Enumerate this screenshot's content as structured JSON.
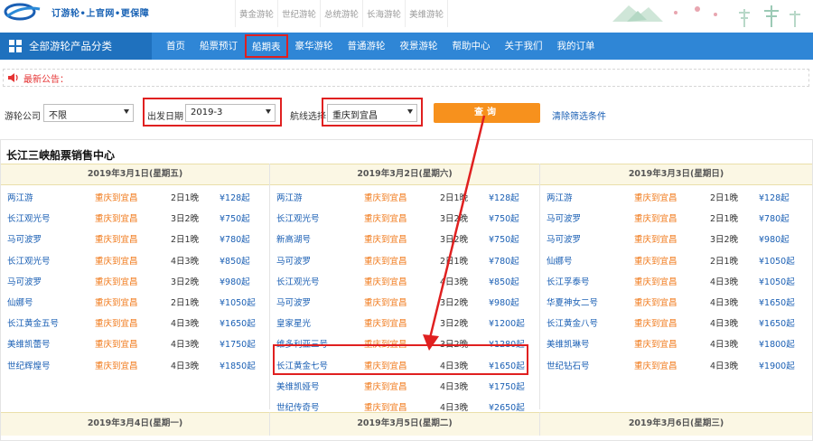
{
  "header": {
    "slogan": "订游轮•上官网•更保障",
    "top_links": [
      "黄金游轮",
      "世纪游轮",
      "总统游轮",
      "长海游轮",
      "美维游轮"
    ]
  },
  "nav": {
    "category_label": "全部游轮产品分类",
    "items": [
      "首页",
      "船票预订",
      "船期表",
      "豪华游轮",
      "普通游轮",
      "夜景游轮",
      "帮助中心",
      "关于我们",
      "我的订单"
    ],
    "active": "船期表"
  },
  "notice": {
    "label": "最新公告："
  },
  "filter": {
    "company_label": "游轮公司",
    "company_value": "不限",
    "date_label": "出发日期",
    "date_value": "2019-3",
    "route_label": "航线选择",
    "route_value": "重庆到宜昌",
    "query_label": "查询",
    "clear_label": "清除筛选条件"
  },
  "schedule": {
    "title": "长江三峡船票销售中心",
    "columns": [
      {
        "date": "2019年3月1日(星期五)",
        "rows": [
          {
            "ship": "两江游",
            "route": "重庆到宜昌",
            "days": "2日1晚",
            "price": "¥128起"
          },
          {
            "ship": "长江观光号",
            "route": "重庆到宜昌",
            "days": "3日2晚",
            "price": "¥750起"
          },
          {
            "ship": "马可波罗",
            "route": "重庆到宜昌",
            "days": "2日1晚",
            "price": "¥780起"
          },
          {
            "ship": "长江观光号",
            "route": "重庆到宜昌",
            "days": "4日3晚",
            "price": "¥850起"
          },
          {
            "ship": "马可波罗",
            "route": "重庆到宜昌",
            "days": "3日2晚",
            "price": "¥980起"
          },
          {
            "ship": "仙娜号",
            "route": "重庆到宜昌",
            "days": "2日1晚",
            "price": "¥1050起"
          },
          {
            "ship": "长江黄金五号",
            "route": "重庆到宜昌",
            "days": "4日3晚",
            "price": "¥1650起"
          },
          {
            "ship": "美维凯蕾号",
            "route": "重庆到宜昌",
            "days": "4日3晚",
            "price": "¥1750起"
          },
          {
            "ship": "世纪辉煌号",
            "route": "重庆到宜昌",
            "days": "4日3晚",
            "price": "¥1850起"
          }
        ]
      },
      {
        "date": "2019年3月2日(星期六)",
        "rows": [
          {
            "ship": "两江游",
            "route": "重庆到宜昌",
            "days": "2日1晚",
            "price": "¥128起"
          },
          {
            "ship": "长江观光号",
            "route": "重庆到宜昌",
            "days": "3日2晚",
            "price": "¥750起"
          },
          {
            "ship": "新高湖号",
            "route": "重庆到宜昌",
            "days": "3日2晚",
            "price": "¥750起"
          },
          {
            "ship": "马可波罗",
            "route": "重庆到宜昌",
            "days": "2日1晚",
            "price": "¥780起"
          },
          {
            "ship": "长江观光号",
            "route": "重庆到宜昌",
            "days": "4日3晚",
            "price": "¥850起"
          },
          {
            "ship": "马可波罗",
            "route": "重庆到宜昌",
            "days": "3日2晚",
            "price": "¥980起"
          },
          {
            "ship": "皇家星光",
            "route": "重庆到宜昌",
            "days": "3日2晚",
            "price": "¥1200起"
          },
          {
            "ship": "维多利亚三号",
            "route": "重庆到宜昌",
            "days": "3日2晚",
            "price": "¥1280起"
          },
          {
            "ship": "长江黄金七号",
            "route": "重庆到宜昌",
            "days": "4日3晚",
            "price": "¥1650起"
          },
          {
            "ship": "美维凯娅号",
            "route": "重庆到宜昌",
            "days": "4日3晚",
            "price": "¥1750起"
          },
          {
            "ship": "世纪传奇号",
            "route": "重庆到宜昌",
            "days": "4日3晚",
            "price": "¥2650起"
          }
        ]
      },
      {
        "date": "2019年3月3日(星期日)",
        "rows": [
          {
            "ship": "两江游",
            "route": "重庆到宜昌",
            "days": "2日1晚",
            "price": "¥128起"
          },
          {
            "ship": "马可波罗",
            "route": "重庆到宜昌",
            "days": "2日1晚",
            "price": "¥780起"
          },
          {
            "ship": "马可波罗",
            "route": "重庆到宜昌",
            "days": "3日2晚",
            "price": "¥980起"
          },
          {
            "ship": "仙娜号",
            "route": "重庆到宜昌",
            "days": "2日1晚",
            "price": "¥1050起"
          },
          {
            "ship": "长江孚泰号",
            "route": "重庆到宜昌",
            "days": "4日3晚",
            "price": "¥1050起"
          },
          {
            "ship": "华夏神女二号",
            "route": "重庆到宜昌",
            "days": "4日3晚",
            "price": "¥1650起"
          },
          {
            "ship": "长江黄金八号",
            "route": "重庆到宜昌",
            "days": "4日3晚",
            "price": "¥1650起"
          },
          {
            "ship": "美维凯琳号",
            "route": "重庆到宜昌",
            "days": "4日3晚",
            "price": "¥1800起"
          },
          {
            "ship": "世纪钻石号",
            "route": "重庆到宜昌",
            "days": "4日3晚",
            "price": "¥1900起"
          }
        ]
      }
    ],
    "next_dates": [
      "2019年3月4日(星期一)",
      "2019年3月5日(星期二)",
      "2019年3月6日(星期三)"
    ]
  }
}
